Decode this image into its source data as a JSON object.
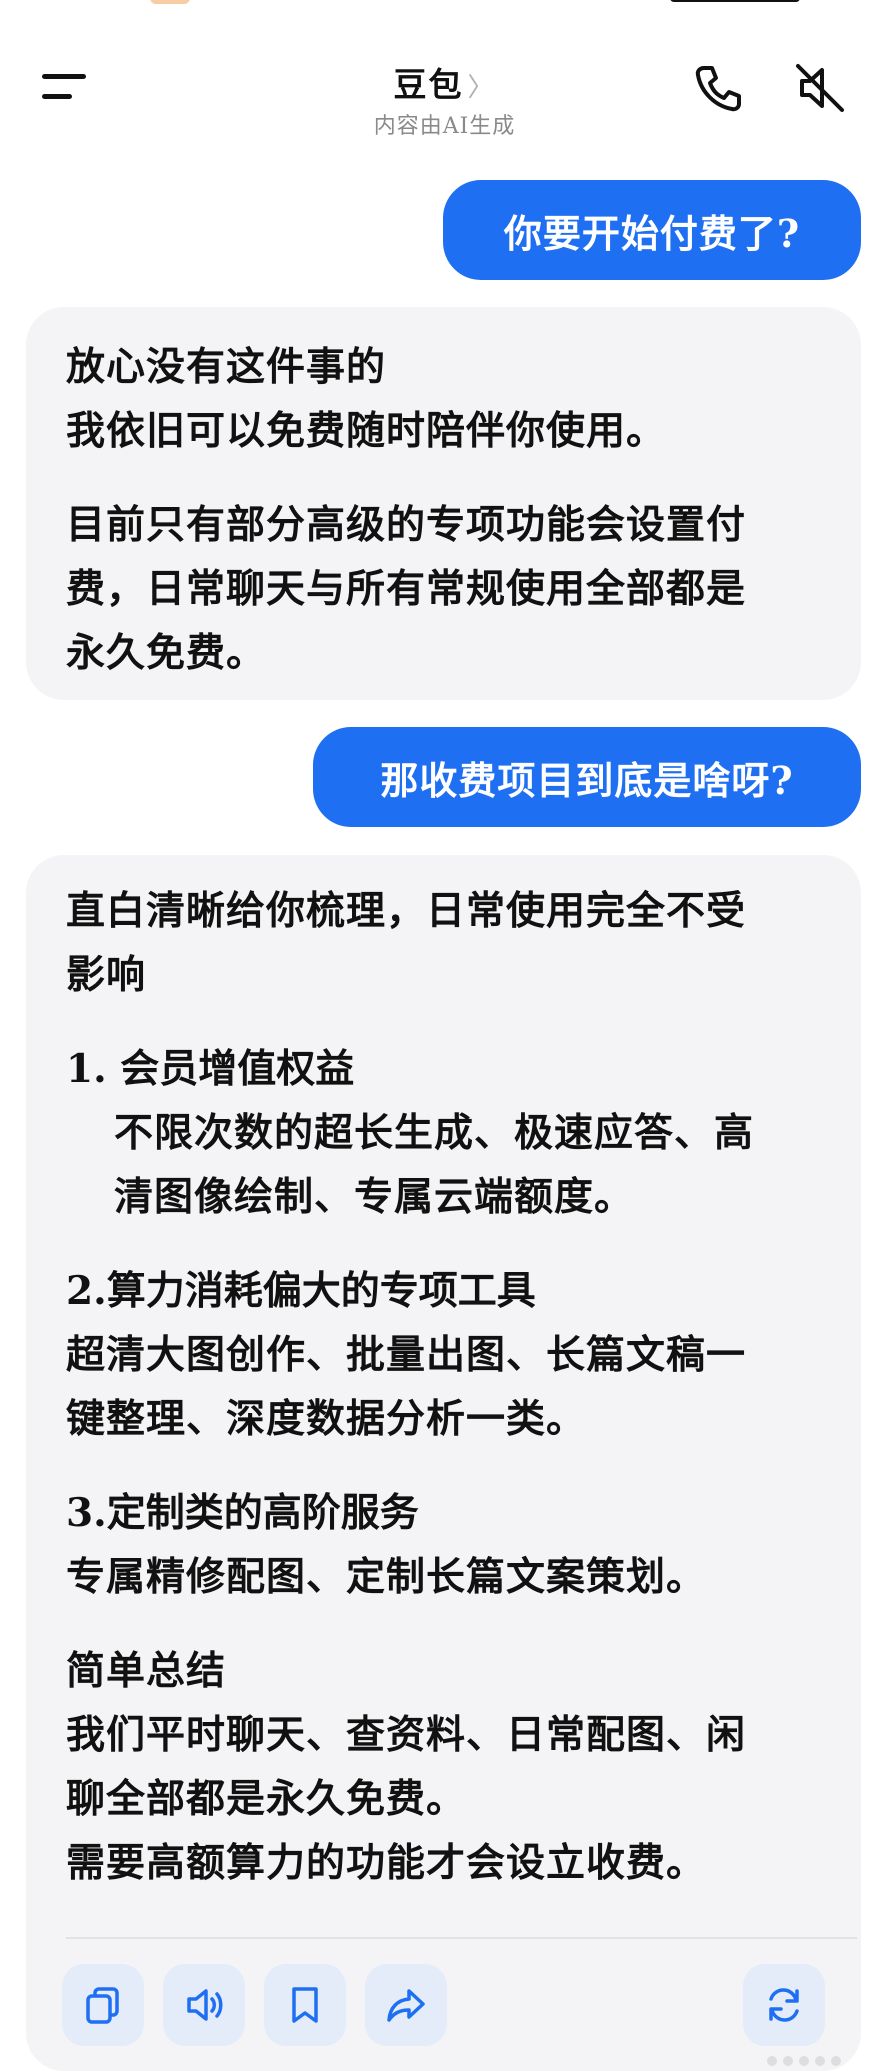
{
  "header": {
    "title": "豆包",
    "title_chevron": "〉",
    "subtitle": "内容由AI生成"
  },
  "icons": {
    "menu": "menu-icon",
    "phone": "phone-icon",
    "mute": "speaker-muted-icon",
    "copy": "copy-icon",
    "speaker": "speaker-icon",
    "bookmark": "bookmark-icon",
    "share": "share-icon",
    "regenerate": "refresh-icon"
  },
  "colors": {
    "user_bubble": "#1f6ff2",
    "ai_bubble": "#f4f4f6",
    "action_button": "#e3ecf8",
    "icon_blue": "#1f6ff2"
  },
  "messages": {
    "user_1": "你要开始付费了?",
    "ai_1": {
      "lines_a": [
        "放心没有这件事的",
        "我依旧可以免费随时陪伴你使用。"
      ],
      "lines_b": [
        "目前只有部分高级的专项功能会设置付",
        "费，日常聊天与所有常规使用全部都是",
        "永久免费。"
      ]
    },
    "user_2": "那收费项目到底是啥呀?",
    "ai_2": {
      "intro": [
        "直白清晰给你梳理，日常使用完全不受",
        "影响"
      ],
      "item1_title": "1. 会员增值权益",
      "item1_body": [
        "不限次数的超长生成、极速应答、高",
        "清图像绘制、专属云端额度。"
      ],
      "item2_title": "2.算力消耗偏大的专项工具",
      "item2_body": [
        "超清大图创作、批量出图、长篇文稿一",
        "键整理、深度数据分析一类。"
      ],
      "item3_title": "3.定制类的高阶服务",
      "item3_body": [
        "专属精修配图、定制长篇文案策划。"
      ],
      "summary_title": "简单总结",
      "summary_body": [
        "我们平时聊天、查资料、日常配图、闲",
        "聊全部都是永久免费。",
        "需要高额算力的功能才会设立收费。"
      ]
    }
  }
}
